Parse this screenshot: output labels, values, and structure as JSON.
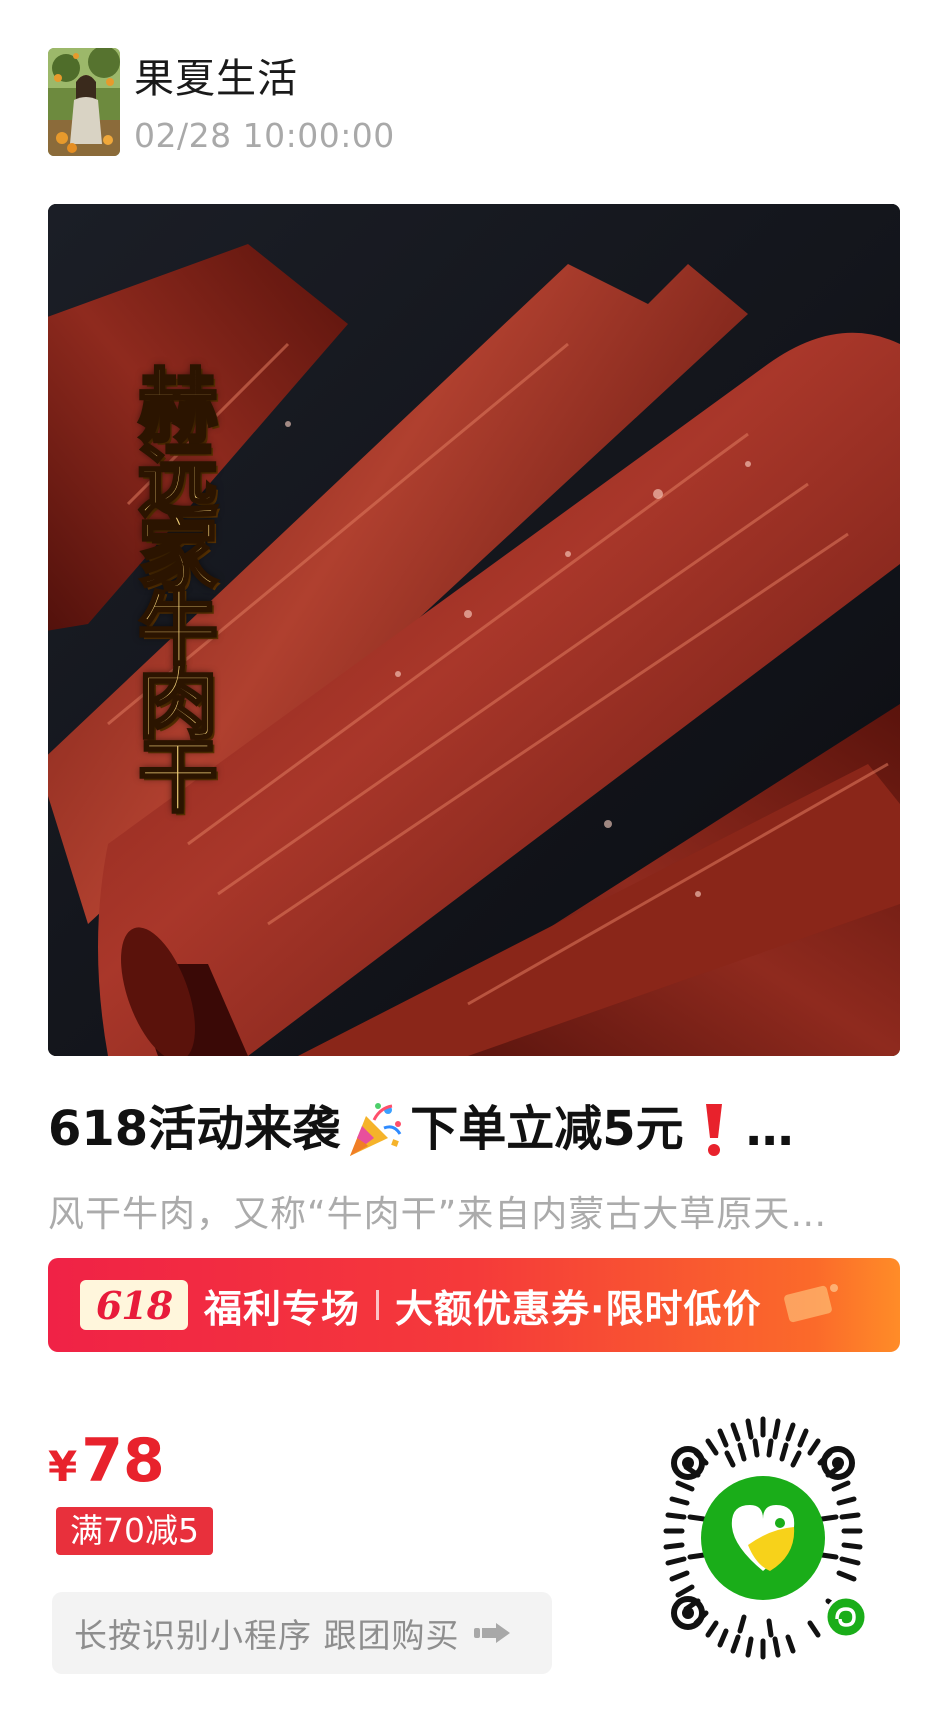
{
  "post": {
    "shop_name": "果夏生活",
    "time": "02/28 10:00:00"
  },
  "hero": {
    "caption": "赫远家牛肉干"
  },
  "product": {
    "title_part1": "618活动来袭",
    "title_part2": "下单立减5元",
    "ellipsis": "…",
    "description": "风干牛肉，又称“牛肉干”来自内蒙古大草原天…",
    "price_symbol": "¥",
    "price": "78",
    "discount_tag": "满70减5"
  },
  "promo": {
    "logo": "618",
    "main": "福利专场",
    "sub": "大额优惠券·限时低价"
  },
  "cta": {
    "label": "长按识别小程序 跟团购买"
  },
  "icons": {
    "party": "party-popper-icon",
    "exclaim": "red-exclamation-icon",
    "arrow": "hand-pointer-arrow-icon",
    "miniprogram": "mini-program-icon"
  },
  "colors": {
    "price_red": "#e8222c",
    "banner_start": "#f02246",
    "banner_end": "#ff8c28",
    "mini_program_green": "#1aad19"
  }
}
